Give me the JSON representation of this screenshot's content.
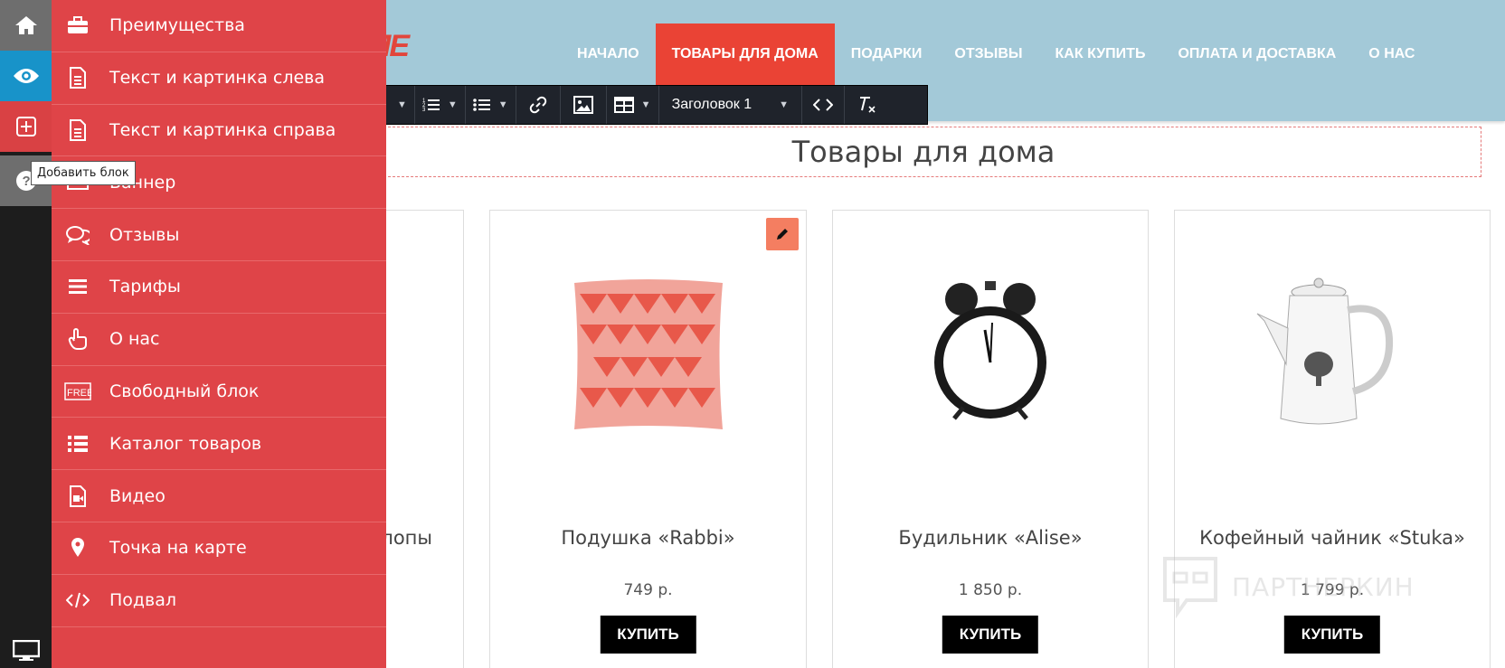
{
  "site": {
    "logo_fragment": "ME",
    "nav": [
      {
        "label": "Начало"
      },
      {
        "label": "Товары для дома"
      },
      {
        "label": "Подарки"
      },
      {
        "label": "Отзывы"
      },
      {
        "label": "Как купить"
      },
      {
        "label": "Оплата и доставка"
      },
      {
        "label": "О нас"
      }
    ],
    "active_nav_index": 1
  },
  "editor": {
    "heading_select": "Заголовок 1",
    "icons": [
      "highlight-icon",
      "ordered-list-icon",
      "bullet-list-icon",
      "link-icon",
      "image-icon",
      "table-icon",
      "code-icon",
      "clear-format-icon"
    ]
  },
  "main": {
    "title": "Товары для дома",
    "products": [
      {
        "name": "…лопы",
        "price": "",
        "buy_label": ""
      },
      {
        "name": "Подушка «Rabbi»",
        "price": "749 р.",
        "buy_label": "Купить"
      },
      {
        "name": "Будильник «Alise»",
        "price": "1 850 р.",
        "buy_label": "Купить"
      },
      {
        "name": "Кофейный чайник «Stuka»",
        "price": "1 799 р.",
        "buy_label": "Купить"
      }
    ]
  },
  "block_menu": {
    "items": [
      {
        "label": "Преимущества",
        "icon": "briefcase-icon"
      },
      {
        "label": "Текст и картинка слева",
        "icon": "document-icon"
      },
      {
        "label": "Текст и картинка справа",
        "icon": "document-icon"
      },
      {
        "label": "Баннер",
        "icon": "banner-icon"
      },
      {
        "label": "Отзывы",
        "icon": "comments-icon"
      },
      {
        "label": "Тарифы",
        "icon": "bars-icon"
      },
      {
        "label": "О нас",
        "icon": "hand-pointer-icon"
      },
      {
        "label": "Свободный блок",
        "icon": "free-icon"
      },
      {
        "label": "Каталог товаров",
        "icon": "list-icon"
      },
      {
        "label": "Видео",
        "icon": "video-file-icon"
      },
      {
        "label": "Точка на карте",
        "icon": "map-marker-icon"
      },
      {
        "label": "Подвал",
        "icon": "code-icon"
      }
    ]
  },
  "rail": {
    "tooltip": "Добавить блок",
    "icons": [
      "home-icon",
      "eye-icon",
      "plus-square-icon",
      "question-icon",
      "desktop-icon"
    ]
  },
  "watermark": {
    "text": "ПАРТНЕРКИН"
  },
  "colors": {
    "menu_red": "#df4448",
    "header_blue": "#a3c9d8",
    "active_nav": "#ea4335",
    "rail_blue": "#1893c9"
  }
}
